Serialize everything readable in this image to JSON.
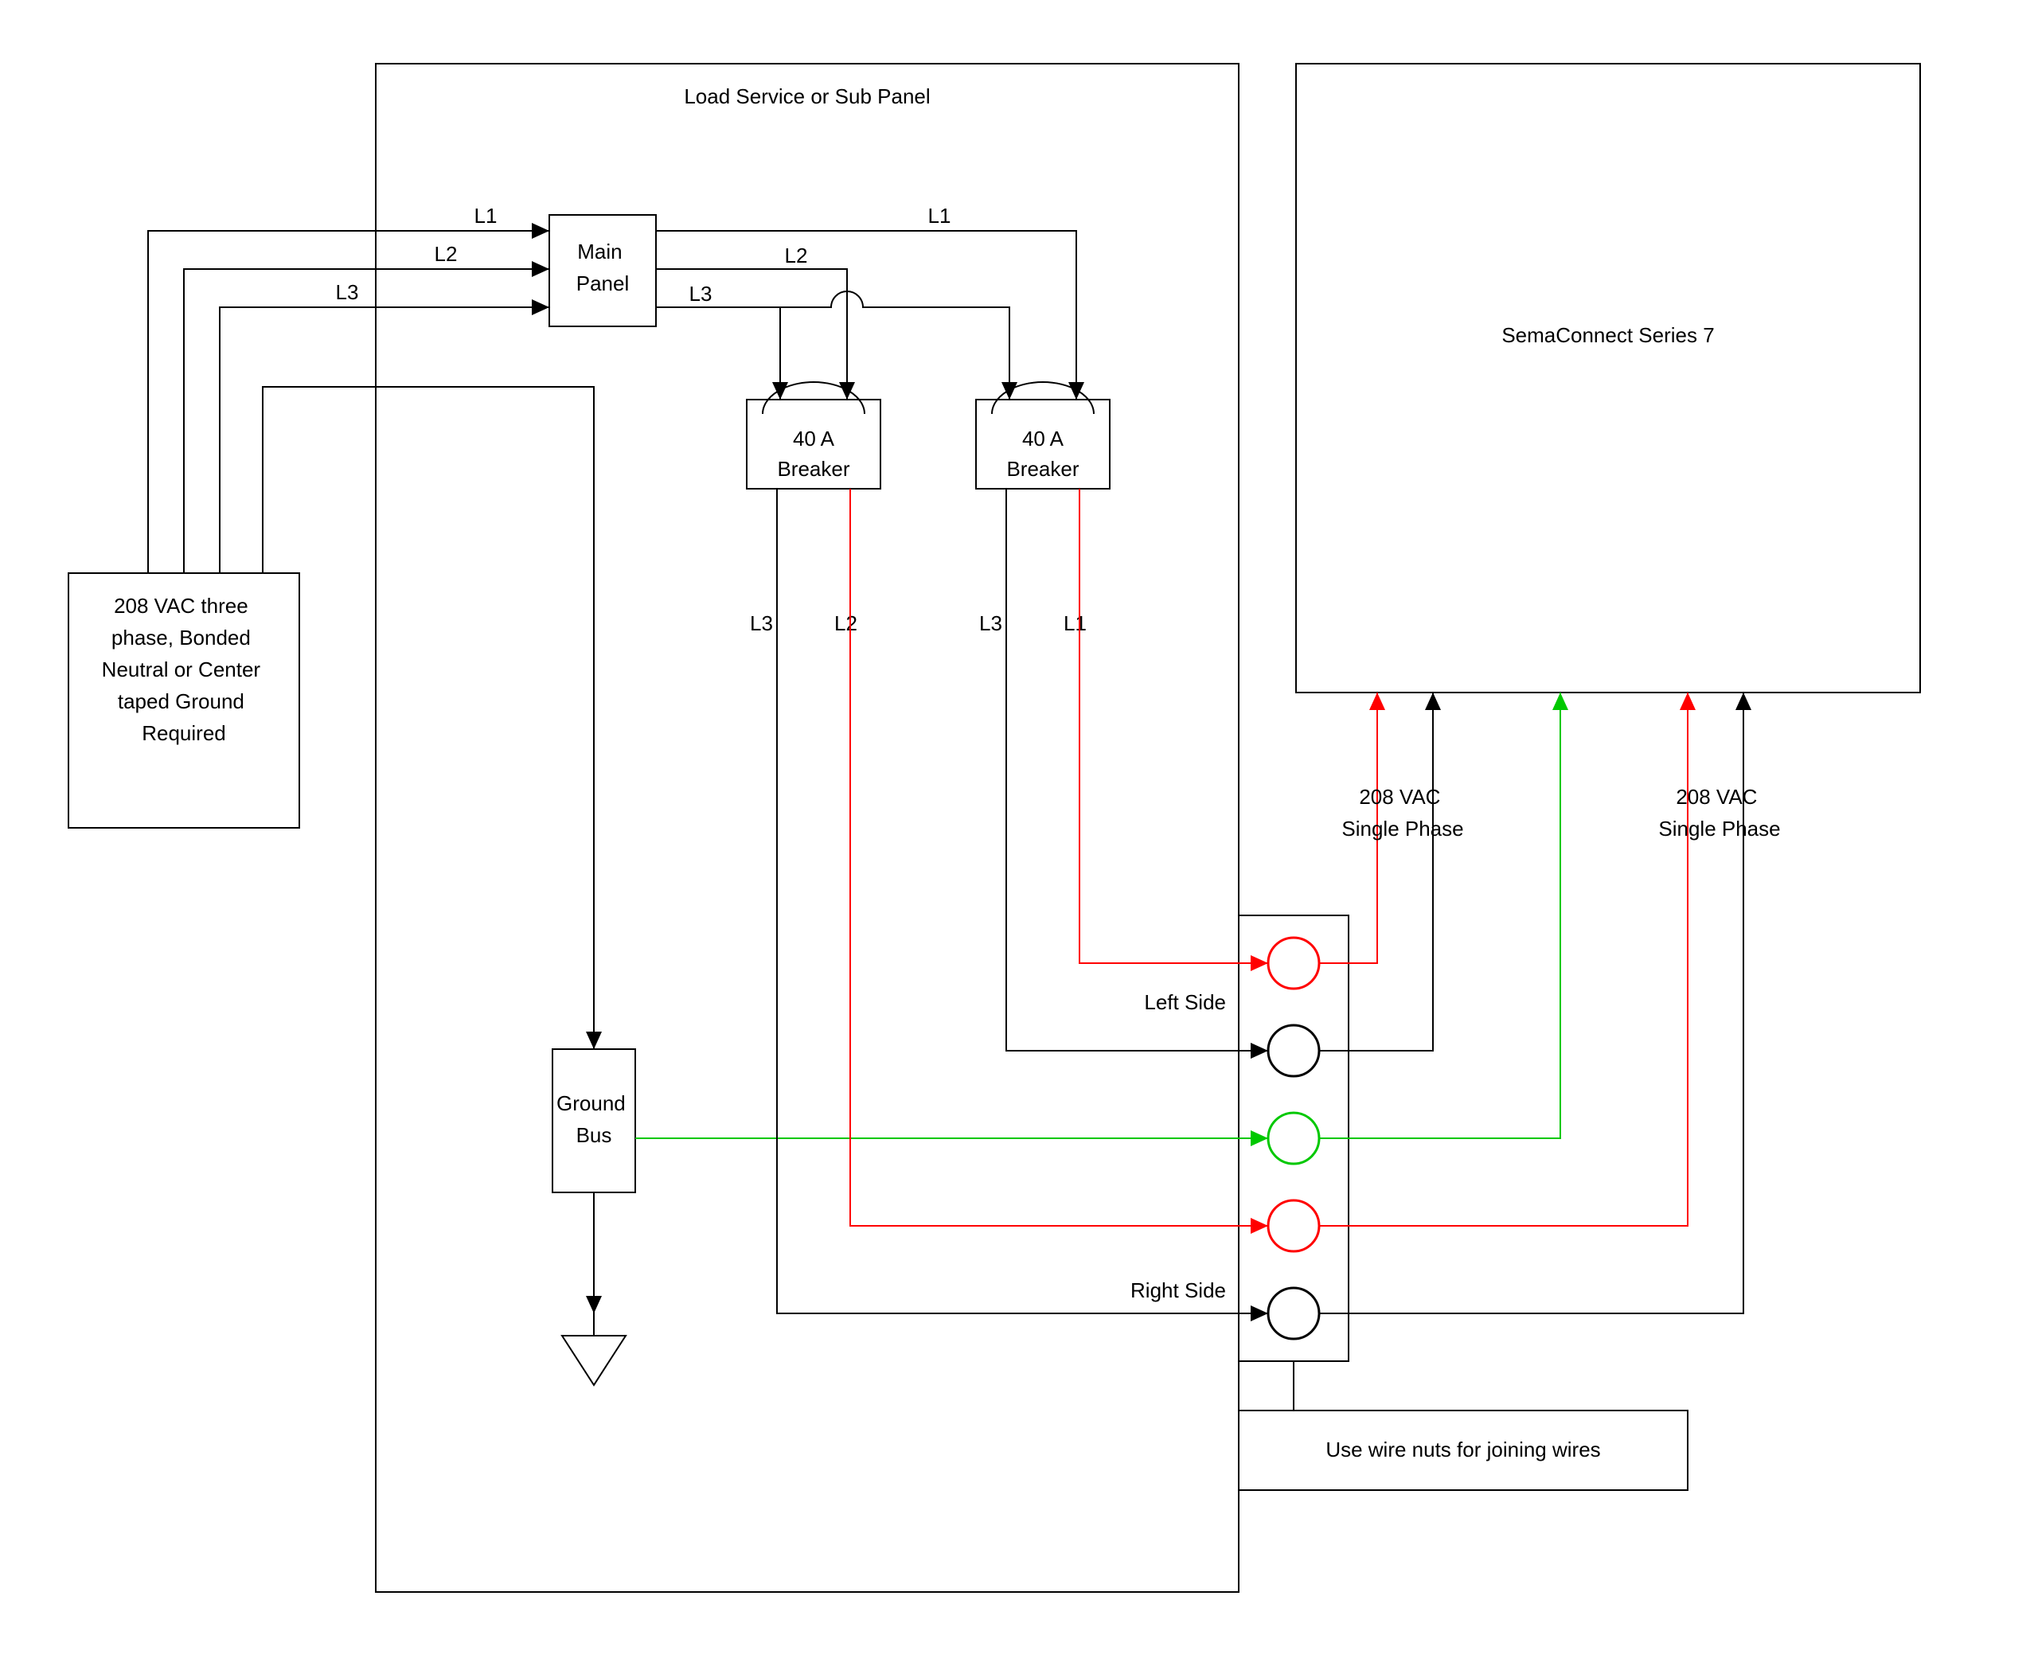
{
  "panel_title": "Load Service or Sub Panel",
  "source_box": "208 VAC three phase, Bonded Neutral or Center taped Ground Required",
  "main_panel": "Main Panel",
  "breaker1_line1": "40 A",
  "breaker1_line2": "Breaker",
  "breaker2_line1": "40 A",
  "breaker2_line2": "Breaker",
  "ground_bus": "Ground Bus",
  "device_title": "SemaConnect Series 7",
  "vac_label_left": "208 VAC Single Phase",
  "vac_label_right": "208 VAC Single Phase",
  "left_side": "Left Side",
  "right_side": "Right Side",
  "wire_nuts": "Use wire nuts for joining wires",
  "L1": "L1",
  "L2": "L2",
  "L3": "L3"
}
